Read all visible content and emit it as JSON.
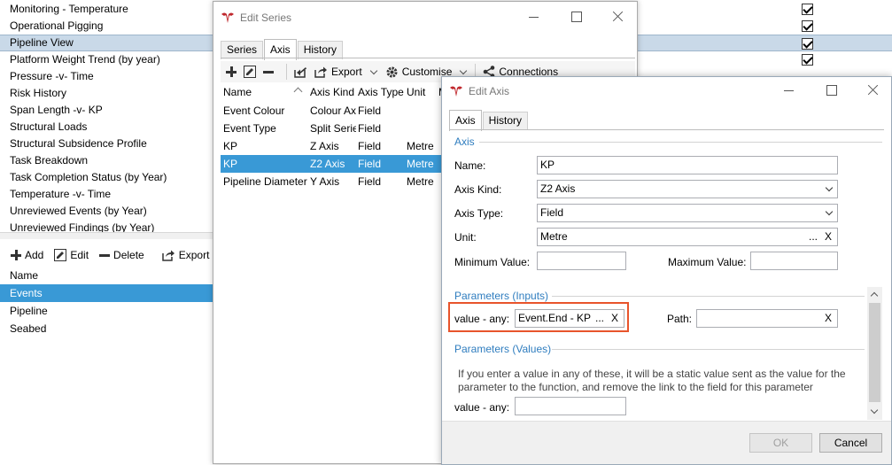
{
  "background": {
    "list_items": [
      "Monitoring - Temperature",
      "Operational Pigging",
      "Pipeline View",
      "Platform Weight Trend (by year)",
      "Pressure -v- Time",
      "Risk History",
      "Span Length -v- KP",
      "Structural Loads",
      "Structural Subsidence Profile",
      "Task Breakdown",
      "Task Completion Status (by Year)",
      "Temperature -v- Time",
      "Unreviewed Events (by Year)",
      "Unreviewed Findings (by Year)"
    ],
    "selected_index": 2,
    "toolbar": {
      "add": "Add",
      "edit": "Edit",
      "delete": "Delete",
      "export": "Export"
    },
    "table_header": "Name",
    "table_rows": [
      "Events",
      "Pipeline",
      "Seabed"
    ],
    "selected_row": 0
  },
  "edit_series": {
    "title": "Edit Series",
    "tabs": [
      "Series",
      "Axis",
      "History"
    ],
    "active_tab": 1,
    "toolbar": {
      "export": "Export",
      "customise": "Customise",
      "connections": "Connections"
    },
    "columns": [
      "Name",
      "Axis Kind",
      "Axis Type",
      "Unit",
      "M"
    ],
    "rows": [
      [
        "Event Colour",
        "Colour Ax",
        "Field",
        ""
      ],
      [
        "Event Type",
        "Split Serie",
        "Field",
        ""
      ],
      [
        "KP",
        "Z Axis",
        "Field",
        "Metre"
      ],
      [
        "KP",
        "Z2 Axis",
        "Field",
        "Metre"
      ],
      [
        "Pipeline Diameter",
        "Y Axis",
        "Field",
        "Metre"
      ]
    ],
    "selected_row": 3
  },
  "edit_axis": {
    "title": "Edit Axis",
    "tabs": [
      "Axis",
      "History"
    ],
    "active_tab": 0,
    "section_axis": "Axis",
    "name_label": "Name:",
    "name_value": "KP",
    "kind_label": "Axis Kind:",
    "kind_value": "Z2 Axis",
    "type_label": "Axis Type:",
    "type_value": "Field",
    "unit_label": "Unit:",
    "unit_value": "Metre",
    "min_label": "Minimum Value:",
    "max_label": "Maximum Value:",
    "section_inputs": "Parameters (Inputs)",
    "param_label": "value - any:",
    "param_value": "Event.End - KP",
    "path_label": "Path:",
    "section_values": "Parameters (Values)",
    "help_text": "If you enter a value in any of these, it will be a static value sent as the value for the parameter to the function, and remove the link to the field for this parameter",
    "value_label": "value - any:",
    "ok": "OK",
    "cancel": "Cancel",
    "ellipsis": "...",
    "clear": "X"
  },
  "colors": {
    "accent": "#3999d6",
    "highlight": "#e8542c",
    "section": "#2f7dbf"
  }
}
